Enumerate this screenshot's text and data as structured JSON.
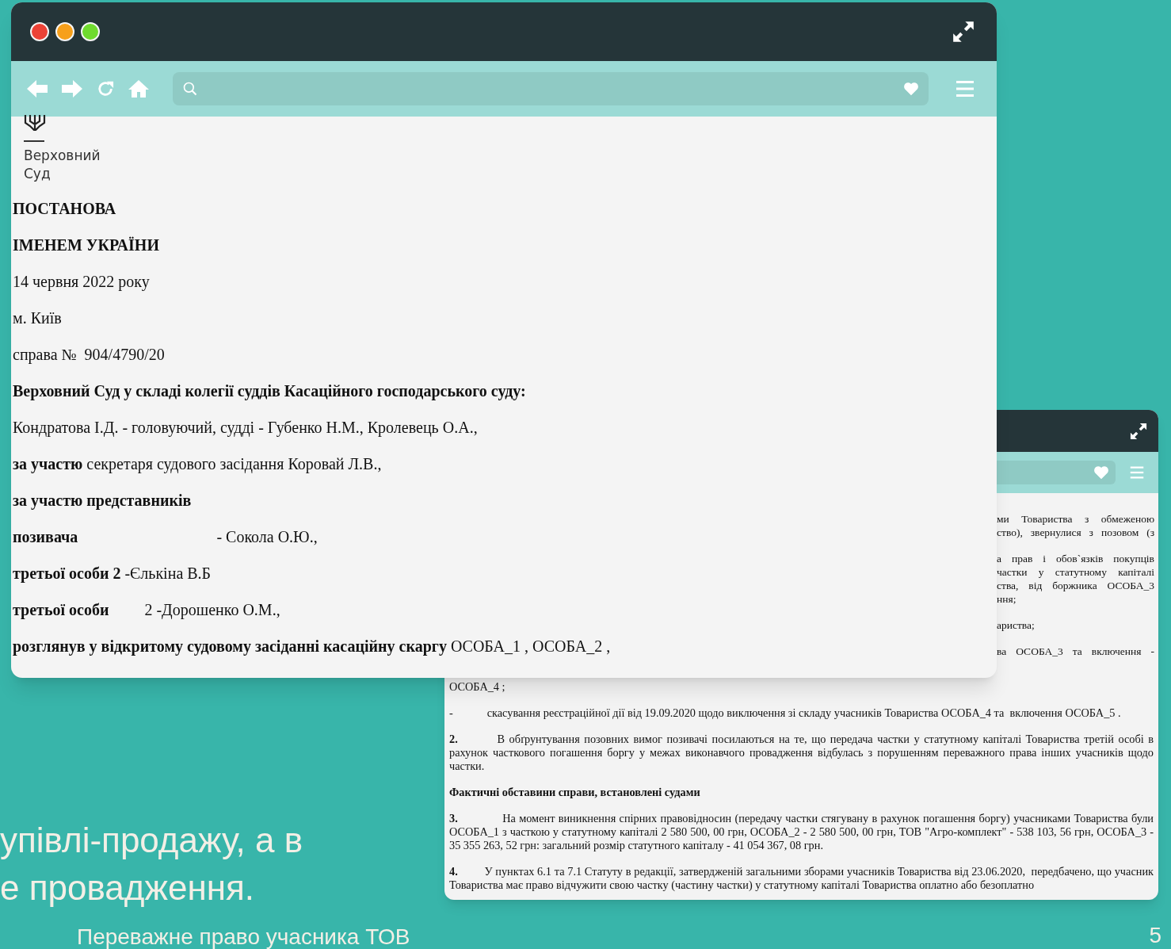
{
  "slide": {
    "heading_lines": [
      "упівлі-продажу, а в",
      "е провадження."
    ],
    "footer": "Переважне право учасника ТОВ",
    "page_number": "5"
  },
  "front_window": {
    "logo_lines": [
      "Верховний",
      "Суд"
    ],
    "paragraphs": [
      {
        "text": "ПОСТАНОВА",
        "kind": "bold"
      },
      {
        "text": "ІМЕНЕМ УКРАЇНИ",
        "kind": "bold"
      },
      {
        "text": "14 червня 2022 року",
        "kind": "plain"
      },
      {
        "text": "м. Київ",
        "kind": "plain"
      },
      {
        "text": "справа №  904/4790/20",
        "kind": "plain"
      },
      {
        "text": "Верховний Суд у складі колегії суддів Касаційного господарського суду:",
        "kind": "bold"
      },
      {
        "text": "Кондратова І.Д. - головуючий, судді - Губенко Н.М., Кролевець О.А.,",
        "kind": "plain"
      },
      {
        "text": "**за участю** секретаря судового засідання Коровай Л.В.,",
        "kind": "plain"
      },
      {
        "text": "за участю представників",
        "kind": "bold"
      },
      {
        "text": "**позивача**                                   - Сокола О.Ю.,",
        "kind": "plain"
      },
      {
        "text": "**третьої особи 2** -Єлькіна В.Б",
        "kind": "plain"
      },
      {
        "text": "**третьої особи**         2 -Дорошенко О.М.,",
        "kind": "plain"
      },
      {
        "text": "**розглянув у відкритому судовому засіданні касаційну скаргу** ОСОБА_1 , ОСОБА_2 ,",
        "kind": "plain"
      }
    ]
  },
  "back_window": {
    "fragments": [
      {
        "text": "ми Товариства з обмеженою",
        "kind": "line"
      },
      {
        "text": "ство), звернулися з позовом (з",
        "kind": "line"
      },
      {
        "text": "а прав і обов`язків покупців",
        "kind": "line",
        "gap_before": true
      },
      {
        "text": "частки у статутному капіталі",
        "kind": "line"
      },
      {
        "text": "ства, від боржника ОСОБА_3",
        "kind": "line"
      },
      {
        "text": "ння;",
        "kind": "last"
      },
      {
        "text": "ариства;",
        "kind": "last",
        "gap_before": true
      },
      {
        "text": "ва ОСОБА_3 та включення -",
        "kind": "line",
        "gap_before": true
      }
    ],
    "paragraphs": [
      {
        "text": "ОСОБА_4 ;",
        "kind": "plain"
      },
      {
        "text": "-            скасування реєстраційної дії від 19.09.2020 щодо виключення зі складу учасників Товариства ОСОБА_4 та  включення ОСОБА_5 .",
        "kind": "plain"
      },
      {
        "text": "**2.**         В обґрунтування позовних вимог позивачі посилаються на те, що передача частки у статутному капіталі Товариства третій особі в рахунок часткового погашення боргу у межах виконавчого провадження відбулась з порушенням переважного права інших учасників щодо частки.",
        "kind": "plain"
      },
      {
        "text": "Фактичні обставини справи, встановлені судами",
        "kind": "bold"
      },
      {
        "text": "**3.**             На момент виникнення спірних правовідносин (передачу частки стягувану в рахунок погашення боргу) учасниками Товариства були ОСОБА_1 з часткою у статутному капіталі 2 580 500, 00 грн, ОСОБА_2 - 2 580 500, 00 грн, ТОВ \"Агро-комплект\" - 538 103, 56 грн, ОСОБА_3 - 35 355 263, 52 грн: загальний розмір статутного капіталу - 41 054 367, 08 грн.",
        "kind": "plain"
      },
      {
        "text": "**4.**         У пунктах 6.1 та 7.1 Статуту в редакції, затвердженій загальними зборами учасників Товариства від 23.06.2020,  передбачено, що учасник Товариства має право відчужити свою частку (частину частки) у статутному капіталі Товариства оплатно або безоплатно",
        "kind": "plain"
      }
    ]
  }
}
